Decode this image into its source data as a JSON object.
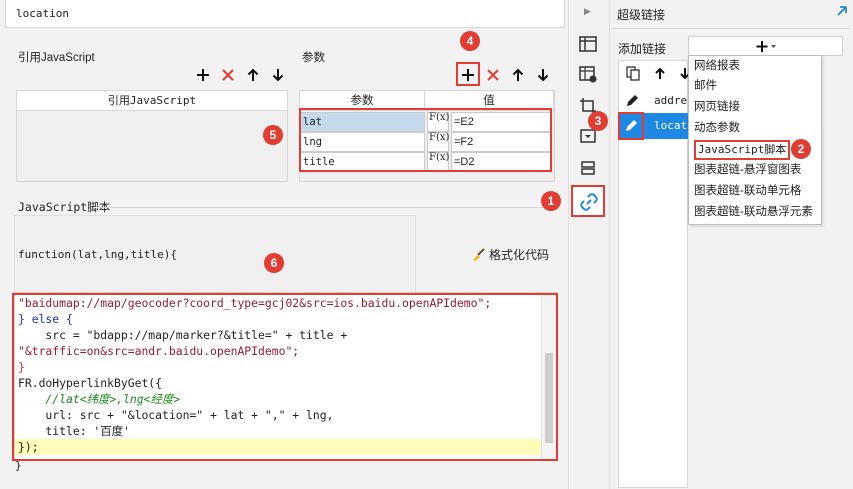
{
  "dialog": {
    "location_label": "location",
    "js_section_label": "引用JavaScript",
    "js_table_header": "引用JavaScript",
    "params_section_label": "参数",
    "params_header_name": "参数",
    "params_header_value": "值",
    "params": [
      {
        "name": "lat",
        "fx": "F(x)",
        "value": "=E2",
        "selected": true
      },
      {
        "name": "lng",
        "fx": "F(x)",
        "value": "=F2",
        "selected": false
      },
      {
        "name": "title",
        "fx": "F(x)",
        "value": "=D2",
        "selected": false
      }
    ],
    "script_section_label": "JavaScript脚本",
    "function_signature": "function(lat,lng,title){",
    "format_code_label": "格式化代码",
    "closing_brace": "}",
    "code_lines": [
      "\"baidumap://map/geocoder?coord_type=gcj02&src=ios.baidu.openAPIdemo\";",
      "} else {",
      "    src = \"bdapp://map/marker?&title=\" + title +",
      "\"&traffic=on&src=andr.baidu.openAPIdemo\";",
      "}",
      "FR.doHyperlinkByGet({",
      "    //lat<纬度>,lng<经度>",
      "    url: src + \"&location=\" + lat + \",\" + lng,",
      "    title: '百度'",
      "});"
    ]
  },
  "right_panel": {
    "title": "超级链接",
    "add_link_label": "添加链接",
    "links": [
      {
        "label": "addres"
      },
      {
        "label": "locati"
      }
    ],
    "dropdown_items": [
      "网络报表",
      "邮件",
      "网页链接",
      "动态参数",
      "JavaScript脚本",
      "图表超链-悬浮窗图表",
      "图表超链-联动单元格",
      "图表超链-联动悬浮元素"
    ]
  },
  "badges": [
    "1",
    "2",
    "3",
    "4",
    "5",
    "6"
  ],
  "colors": {
    "annotation_red": "#e23c33",
    "selected_link_blue": "#1e88e5",
    "selected_row": "#c5d9ec",
    "highlight_line": "#fffbb8"
  }
}
